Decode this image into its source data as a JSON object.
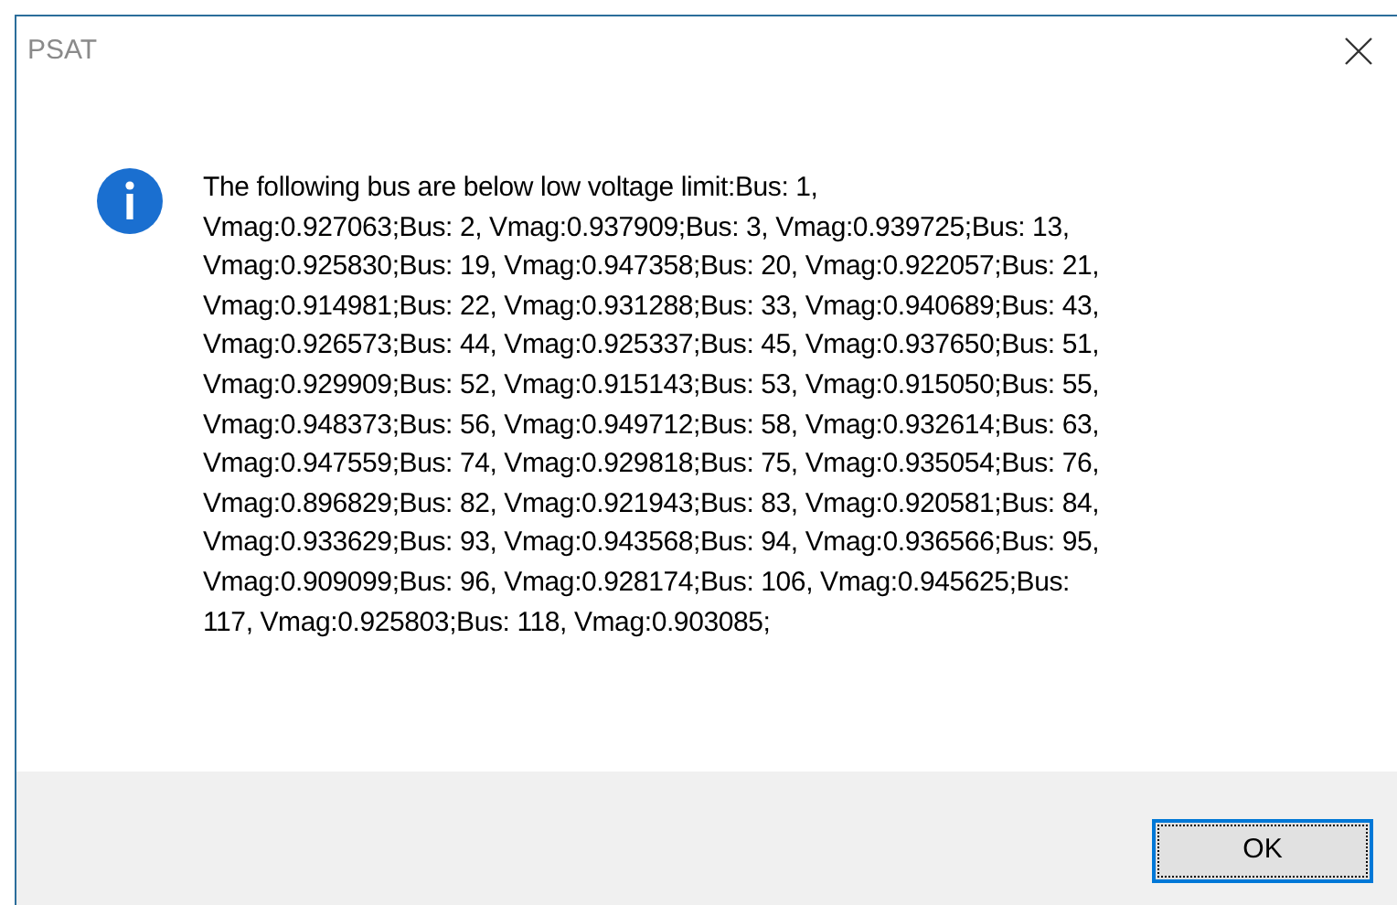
{
  "window": {
    "title": "PSAT"
  },
  "message": "The following bus are below low voltage limit:Bus: 1,\nVmag:0.927063;Bus: 2, Vmag:0.937909;Bus: 3, Vmag:0.939725;Bus: 13,\nVmag:0.925830;Bus: 19, Vmag:0.947358;Bus: 20, Vmag:0.922057;Bus: 21,\nVmag:0.914981;Bus: 22, Vmag:0.931288;Bus: 33, Vmag:0.940689;Bus: 43,\nVmag:0.926573;Bus: 44, Vmag:0.925337;Bus: 45, Vmag:0.937650;Bus: 51,\nVmag:0.929909;Bus: 52, Vmag:0.915143;Bus: 53, Vmag:0.915050;Bus: 55,\nVmag:0.948373;Bus: 56, Vmag:0.949712;Bus: 58, Vmag:0.932614;Bus: 63,\nVmag:0.947559;Bus: 74, Vmag:0.929818;Bus: 75, Vmag:0.935054;Bus: 76,\nVmag:0.896829;Bus: 82, Vmag:0.921943;Bus: 83, Vmag:0.920581;Bus: 84,\nVmag:0.933629;Bus: 93, Vmag:0.943568;Bus: 94, Vmag:0.936566;Bus: 95,\nVmag:0.909099;Bus: 96, Vmag:0.928174;Bus: 106, Vmag:0.945625;Bus:\n117, Vmag:0.925803;Bus: 118, Vmag:0.903085;",
  "buttons": [
    {
      "label": "OK",
      "focused": true
    }
  ]
}
